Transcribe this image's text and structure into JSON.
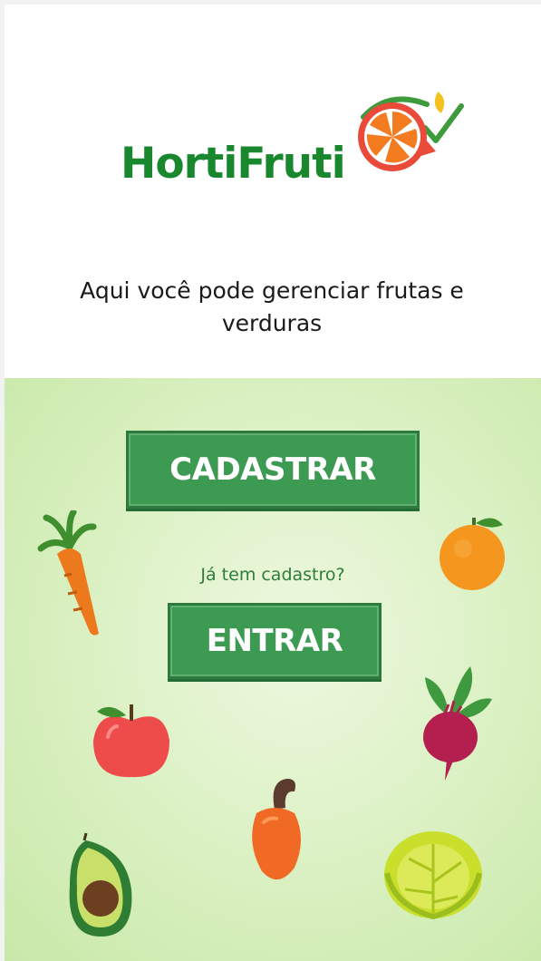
{
  "header": {
    "brand_name": "HortiFruti",
    "tagline": "Aqui você pode gerenciar frutas e verduras"
  },
  "actions": {
    "register_label": "CADASTRAR",
    "question": "Já tem cadastro?",
    "login_label": "ENTRAR"
  },
  "colors": {
    "brand_green": "#19872e",
    "button_green": "#3d9a53",
    "panel_green": "#d9f0c0",
    "logo_orange": "#f47c20",
    "logo_red": "#e94a3a",
    "logo_yellow": "#f4c220"
  },
  "illustrations": [
    "carrot-icon",
    "orange-icon",
    "beet-icon",
    "apple-icon",
    "cashew-icon",
    "avocado-icon",
    "cabbage-icon"
  ]
}
